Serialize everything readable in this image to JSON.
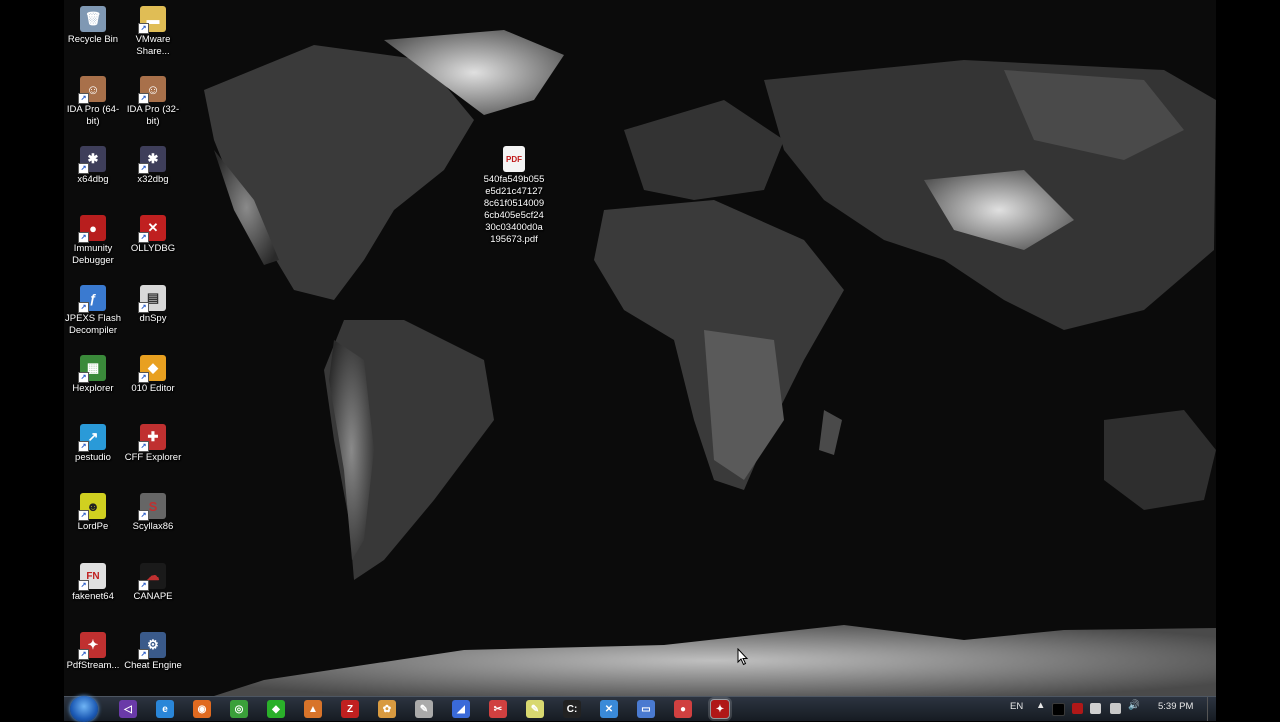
{
  "desktop_icons": [
    {
      "label": "Recycle Bin",
      "icon": "recycle-bin-icon",
      "color": "#8aa4c0",
      "glyph": "🗑"
    },
    {
      "label": "VMware Share...",
      "icon": "folder-icon",
      "color": "#e3c15a",
      "glyph": "▬"
    },
    {
      "label": "IDA Pro (64-bit)",
      "icon": "ida-icon",
      "color": "#b07650",
      "glyph": "☺"
    },
    {
      "label": "IDA Pro (32-bit)",
      "icon": "ida-icon",
      "color": "#b07650",
      "glyph": "☺"
    },
    {
      "label": "x64dbg",
      "icon": "x64dbg-icon",
      "color": "#4a4a66",
      "glyph": "✱"
    },
    {
      "label": "x32dbg",
      "icon": "x32dbg-icon",
      "color": "#4a4a66",
      "glyph": "✱"
    },
    {
      "label": "Immunity Debugger",
      "icon": "immunity-icon",
      "color": "#c02020",
      "glyph": "●"
    },
    {
      "label": "OLLYDBG",
      "icon": "ollydbg-icon",
      "color": "#c02020",
      "glyph": "✕"
    },
    {
      "label": "JPEXS Flash Decompiler",
      "icon": "jpexs-icon",
      "color": "#3a7ad0",
      "glyph": "ƒ"
    },
    {
      "label": "dnSpy",
      "icon": "dnspy-icon",
      "color": "#d8d8d8",
      "glyph": "▤"
    },
    {
      "label": "Hexplorer",
      "icon": "hexplorer-icon",
      "color": "#3a8a3a",
      "glyph": "▦"
    },
    {
      "label": "010 Editor",
      "icon": "010-editor-icon",
      "color": "#e8a020",
      "glyph": "◆"
    },
    {
      "label": "pestudio",
      "icon": "pestudio-icon",
      "color": "#2a9ad8",
      "glyph": "↗"
    },
    {
      "label": "CFF Explorer",
      "icon": "cff-explorer-icon",
      "color": "#c03030",
      "glyph": "✚"
    },
    {
      "label": "LordPe",
      "icon": "lordpe-icon",
      "color": "#d8d820",
      "glyph": "☻"
    },
    {
      "label": "Scylla x86",
      "icon": "scylla-icon",
      "color": "#666",
      "glyph": "S"
    },
    {
      "label": "fakenet64",
      "icon": "fakenet-icon",
      "color": "#e0e0e0",
      "glyph": "FN"
    },
    {
      "label": "CANAPE",
      "icon": "canape-icon",
      "color": "#1a1a1a",
      "glyph": "☁"
    },
    {
      "label": "PdfStream...",
      "icon": "pdfstream-icon",
      "color": "#c03030",
      "glyph": "✦"
    },
    {
      "label": "Cheat Engine",
      "icon": "cheat-engine-icon",
      "color": "#3a5a8a",
      "glyph": "⚙"
    }
  ],
  "desktop_labels": {
    "recycle": "Recycle Bin",
    "vmware": "VMware Share...",
    "ida64": "IDA Pro (64-bit)",
    "ida32": "IDA Pro (32-bit)",
    "x64dbg": "x64dbg",
    "x32dbg": "x32dbg",
    "immunity": "Immunity Debugger",
    "olly": "OLLYDBG",
    "jpexs": "JPEXS Flash Decompiler",
    "dnspy": "dnSpy",
    "hexplorer": "Hexplorer",
    "editor010": "010 Editor",
    "pestudio": "pestudio",
    "cff": "CFF Explorer",
    "lordpe": "LordPe",
    "scylla": "Scyllax86",
    "fakenet": "fakenet64",
    "canape": "CANAPE",
    "pdfstream": "PdfStream...",
    "cheat": "Cheat Engine"
  },
  "pdf_file": {
    "label": "540fa549b055e5d21c47127 8c61f0514009 6cb405e5cf24 30c03400d0a 195673.pdf",
    "lines": [
      "540fa549b055",
      "e5d21c47127",
      "8c61f0514009",
      "6cb405e5cf24",
      "30c03400d0a",
      "195673.pdf"
    ],
    "badge": "PDF"
  },
  "taskbar": {
    "start_icon": "windows-start-icon",
    "apps": [
      {
        "name": "visual-studio-icon",
        "color": "#6a3aa8",
        "glyph": "◁"
      },
      {
        "name": "internet-explorer-icon",
        "color": "#2a86d8",
        "glyph": "e"
      },
      {
        "name": "firefox-icon",
        "color": "#e06a20",
        "glyph": "◉"
      },
      {
        "name": "chrome-icon",
        "color": "#3aa03a",
        "glyph": "◎"
      },
      {
        "name": "green-diamond-icon",
        "color": "#2ab02a",
        "glyph": "◆"
      },
      {
        "name": "tool-icon",
        "color": "#d8742a",
        "glyph": "▲"
      },
      {
        "name": "filezilla-icon",
        "color": "#c02020",
        "glyph": "Z"
      },
      {
        "name": "tool2-icon",
        "color": "#d89a40",
        "glyph": "✿"
      },
      {
        "name": "network-tool-icon",
        "color": "#aaaaaa",
        "glyph": "✎"
      },
      {
        "name": "blue-app-icon",
        "color": "#3a6ad8",
        "glyph": "◢"
      },
      {
        "name": "red-tool-icon",
        "color": "#d04040",
        "glyph": "✂"
      },
      {
        "name": "notepad-icon",
        "color": "#d8d870",
        "glyph": "✎"
      },
      {
        "name": "cmd-icon",
        "color": "#222222",
        "glyph": "C:"
      },
      {
        "name": "process-tool-icon",
        "color": "#3a8ad8",
        "glyph": "✕"
      },
      {
        "name": "explorer-window-icon",
        "color": "#4a7ad0",
        "glyph": "▭"
      },
      {
        "name": "record-icon",
        "color": "#d04040",
        "glyph": "●"
      },
      {
        "name": "acrobat-icon",
        "color": "#b01818",
        "glyph": "✦",
        "active": true
      }
    ],
    "language": "EN",
    "clock": "5:39 PM"
  }
}
